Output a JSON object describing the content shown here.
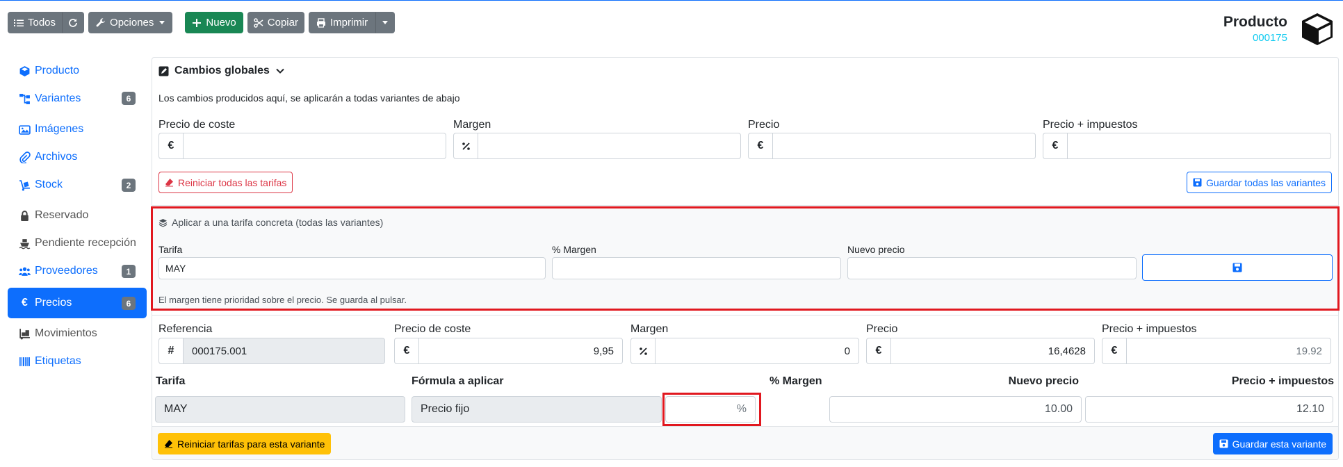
{
  "toolbar": {
    "all_label": "Todos",
    "options_label": "Opciones",
    "new_label": "Nuevo",
    "copy_label": "Copiar",
    "print_label": "Imprimir"
  },
  "header": {
    "title": "Producto",
    "code": "000175"
  },
  "sidebar": {
    "items": [
      {
        "label": "Producto",
        "icon": "cube-icon"
      },
      {
        "label": "Variantes",
        "icon": "sitemap-icon",
        "badge": "6"
      },
      {
        "label": "Imágenes",
        "icon": "images-icon"
      },
      {
        "label": "Archivos",
        "icon": "paperclip-icon"
      },
      {
        "label": "Stock",
        "icon": "dolly-icon",
        "badge": "2"
      },
      {
        "label": "Reservado",
        "icon": "lock-icon"
      },
      {
        "label": "Pendiente recepción",
        "icon": "ship-icon"
      },
      {
        "label": "Proveedores",
        "icon": "users-icon",
        "badge": "1"
      },
      {
        "label": "Precios",
        "icon": "euro-icon",
        "badge": "6",
        "active": true
      },
      {
        "label": "Movimientos",
        "icon": "truck-loading-icon"
      },
      {
        "label": "Etiquetas",
        "icon": "barcode-icon"
      }
    ]
  },
  "global": {
    "title": "Cambios globales",
    "description": "Los cambios producidos aquí, se aplicarán a todas variantes de abajo",
    "cost_label": "Precio de coste",
    "margin_label": "Margen",
    "price_label": "Precio",
    "price_tax_label": "Precio + impuestos",
    "euro_symbol": "€",
    "percent_symbol": "%",
    "reset_all_label": "Reiniciar todas las tarifas",
    "save_all_label": "Guardar todas las variantes"
  },
  "tarifa_concreta": {
    "title": "Aplicar a una tarifa concreta (todas las variantes)",
    "tarifa_label": "Tarifa",
    "tarifa_value": "MAY",
    "margin_label": "% Margen",
    "new_price_label": "Nuevo precio",
    "help": "El margen tiene prioridad sobre el precio. Se guarda al pulsar."
  },
  "variant": {
    "reference_label": "Referencia",
    "reference_symbol": "#",
    "reference_value": "000175.001",
    "cost_label": "Precio de coste",
    "cost_value": "9,95",
    "margin_label": "Margen",
    "margin_value": "0",
    "price_label": "Precio",
    "price_value": "16,4628",
    "price_tax_label": "Precio + impuestos",
    "price_tax_value": "19.92",
    "table": {
      "headers": [
        "Tarifa",
        "Fórmula a aplicar",
        "% Margen",
        "Nuevo precio",
        "Precio + impuestos"
      ],
      "rows": [
        {
          "tarifa": "MAY",
          "formula": "Precio fijo",
          "margin_suffix": "%",
          "new_price": "10.00",
          "price_tax": "12.10"
        }
      ]
    },
    "reset_label": "Reiniciar tarifas para esta variante",
    "save_label": "Guardar esta variante"
  },
  "colors": {
    "primary": "#0d6efd",
    "secondary": "#6c757d",
    "success": "#198754",
    "danger": "#dc3545",
    "warning": "#ffc107",
    "info": "#0dcaf0",
    "highlight": "#e1181f"
  }
}
